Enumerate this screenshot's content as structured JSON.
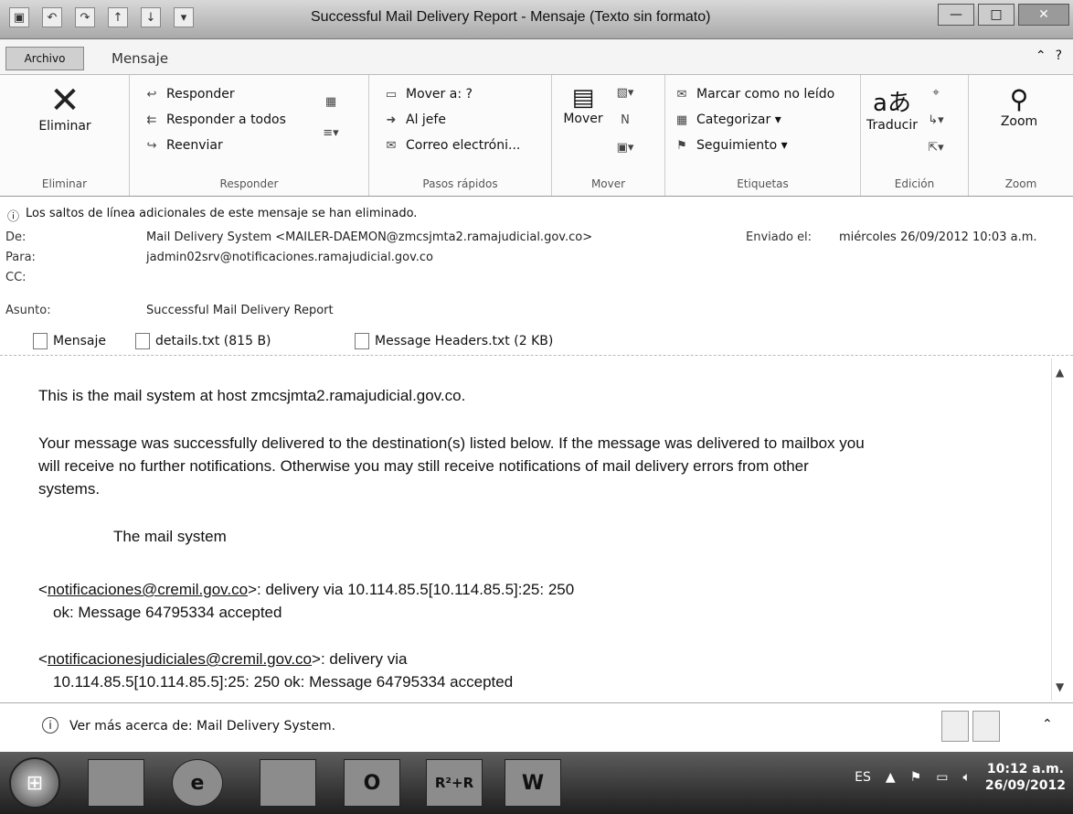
{
  "window": {
    "title": "Successful Mail Delivery Report - Mensaje (Texto sin formato)",
    "controls": [
      "—",
      "□",
      "✕"
    ]
  },
  "ribbon": {
    "file_tab": "Archivo",
    "tab": "Mensaje",
    "groups": {
      "delete": {
        "label": "Eliminar",
        "button": "Eliminar"
      },
      "respond": {
        "label": "Responder",
        "reply": "Responder",
        "reply_all": "Responder a todos",
        "forward": "Reenviar"
      },
      "quick_steps": {
        "label": "Pasos rápidos",
        "move_to": "Mover a: ?",
        "to_manager": "Al jefe",
        "email": "Correo electróni..."
      },
      "move": {
        "label": "Mover",
        "button": "Mover"
      },
      "tags": {
        "label": "Etiquetas",
        "mark_unread": "Marcar como no leído",
        "categorize": "Categorizar ▾",
        "follow_up": "Seguimiento ▾"
      },
      "edit": {
        "label": "Edición",
        "translate": "Traducir"
      },
      "zoom": {
        "label": "Zoom",
        "button": "Zoom"
      }
    }
  },
  "info_bar": "Los saltos de línea adicionales de este mensaje se han eliminado.",
  "headers": {
    "from_label": "De:",
    "from": "Mail Delivery System <MAILER-DAEMON@zmcsjmta2.ramajudicial.gov.co>",
    "sent_label": "Enviado el:",
    "sent": "miércoles 26/09/2012 10:03 a.m.",
    "to_label": "Para:",
    "to": "jadmin02srv@notificaciones.ramajudicial.gov.co",
    "cc_label": "CC:",
    "cc": "",
    "subject_label": "Asunto:",
    "subject": "Successful Mail Delivery Report"
  },
  "attachments": [
    {
      "label": "Mensaje"
    },
    {
      "label": "details.txt (815 B)"
    },
    {
      "label": "Message Headers.txt (2 KB)"
    }
  ],
  "body": {
    "line1": "This is the mail system at host zmcsjmta2.ramajudicial.gov.co.",
    "para2a": "Your message was successfully delivered to the destination(s) listed below. If the message was delivered to mailbox you",
    "para2b": "will receive no further notifications. Otherwise you may still receive notifications of mail delivery errors from other",
    "para2c": "systems.",
    "signature": "The mail system",
    "r1_lt": "<",
    "r1_email": "notificaciones@cremil.gov.co",
    "r1_rest": ">: delivery via 10.114.85.5[10.114.85.5]:25: 250",
    "r1_ok": "ok: Message 64795334 accepted",
    "r2_lt": "<",
    "r2_email": "notificacionesjudiciales@cremil.gov.co",
    "r2_rest": ">: delivery via",
    "r2_cont": "10.114.85.5[10.114.85.5]:25: 250 ok: Message 64795334 accepted"
  },
  "people_pane": "Ver más acerca de: Mail Delivery System.",
  "taskbar": {
    "apps": [
      "",
      "e",
      "",
      "O",
      "R²+R",
      "W"
    ],
    "lang": "ES",
    "time": "10:12 a.m.",
    "date": "26/09/2012"
  }
}
